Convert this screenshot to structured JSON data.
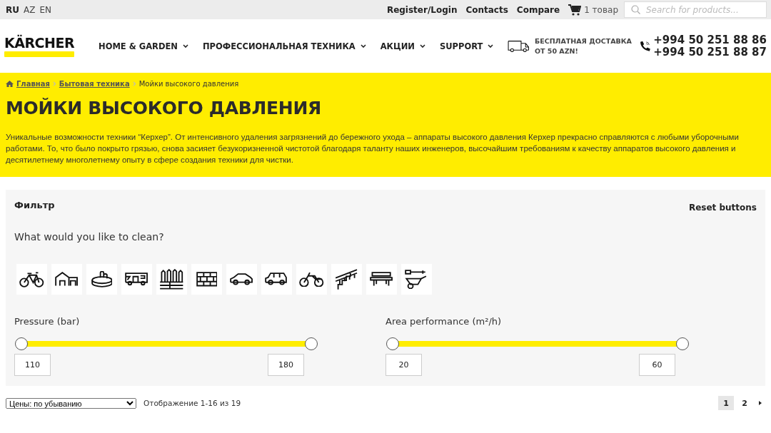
{
  "top_bar": {
    "languages": [
      {
        "label": "RU",
        "selected": true
      },
      {
        "label": "AZ",
        "selected": false
      },
      {
        "label": "EN",
        "selected": false
      }
    ],
    "links": [
      "Register/Login",
      "Contacts",
      "Compare"
    ],
    "cart": {
      "label": "1 товар"
    },
    "search": {
      "placeholder": "Search for products..."
    }
  },
  "header": {
    "logo": "KÄRCHER",
    "nav": [
      "HOME & GARDEN",
      "ПРОФЕССИОНАЛЬНАЯ ТЕХНИКА",
      "АКЦИИ",
      "SUPPORT"
    ],
    "delivery": [
      "БЕСПЛАТНАЯ ДОСТАВКА",
      "ОТ 50 AZN!"
    ],
    "phones": [
      "+994 50 251 88 86",
      "+994 50 251 88 87"
    ]
  },
  "breadcrumbs": [
    "Главная",
    "Бытовая техника",
    "Мойки высокого давления"
  ],
  "page_title": "МОЙКИ ВЫСОКОГО ДАВЛЕНИЯ",
  "description": "Уникальные возможности техники “Керхер”. От интенсивного удаления загрязнений до бережного ухода – аппараты высокого давления Керхер прекрасно справляются с любыми уборочными работами. То, что было покрыто грязью, снова засияет безукоризненной чистотой благодаря таланту наших инженеров, высочайшим требованиям к качеству аппаратов высокого давления и десятилетнему многолетнему опыту в сфере создания техники для чистки.",
  "filter": {
    "title": "Фильтр",
    "reset": "Reset buttons",
    "question": "What would you like to clean?",
    "sliders": [
      {
        "label": "Pressure (bar)",
        "min": {
          "level": 0,
          "value": "110"
        },
        "max": {
          "level": 1,
          "value": "180"
        }
      },
      {
        "label": "Area performance (m²/h)",
        "min": {
          "level": 0,
          "value": "20"
        },
        "max": {
          "level": 1,
          "value": "60"
        }
      }
    ]
  },
  "listing": {
    "sort": "Цены: по убыванию",
    "count": "Отображение 1-16 из 19",
    "pages": [
      {
        "label": "1",
        "selected": true
      },
      {
        "label": "2",
        "selected": false
      }
    ]
  }
}
